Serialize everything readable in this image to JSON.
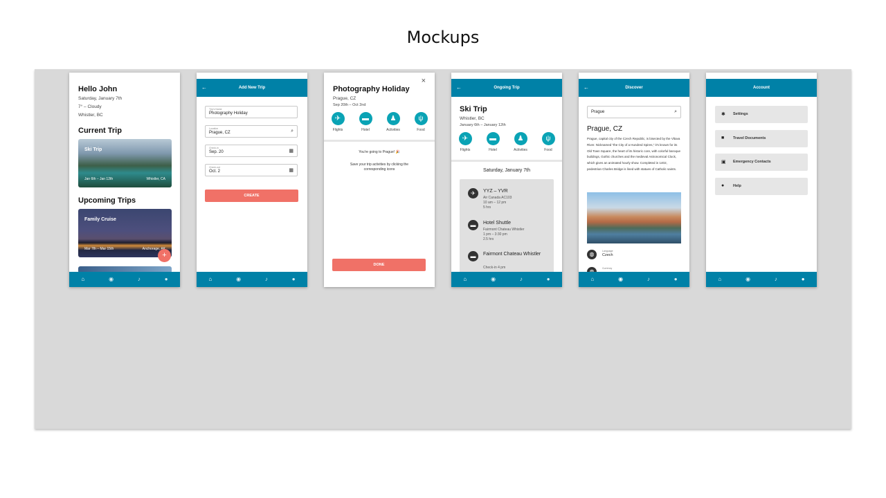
{
  "title": "Mockups",
  "nav_icons": [
    "home-icon",
    "compass-icon",
    "bell-icon",
    "person-icon"
  ],
  "colors": {
    "primary": "#0081a7",
    "accent": "#f07167",
    "icon_teal": "#0aa3b5",
    "board": "#d9d9d9"
  },
  "screen1": {
    "greeting": "Hello John",
    "date": "Saturday, January 7th",
    "weather": "7° – Cloudy",
    "location": "Whistler, BC",
    "current_title": "Current Trip",
    "current_card": {
      "title": "Ski Trip",
      "dates": "Jan 6th – Jan 12th",
      "place": "Whistler, CA"
    },
    "upcoming_title": "Upcoming Trips",
    "upcoming_card": {
      "title": "Family Cruise",
      "dates": "Mar 7th – Mar 15th",
      "place": "Anchorage, AK"
    },
    "fab": "+"
  },
  "screen2": {
    "appbar": "Add New Trip",
    "fields": [
      {
        "label": "Trip's Name",
        "value": "Photography Holiday",
        "icon": ""
      },
      {
        "label": "Location",
        "value": "Prague, CZ",
        "icon": "search-icon"
      },
      {
        "label": "Check-in",
        "value": "Sep. 20",
        "icon": "calendar-icon"
      },
      {
        "label": "Check-out",
        "value": "Oct. 2",
        "icon": "calendar-icon"
      }
    ],
    "button": "CREATE"
  },
  "screen3": {
    "title": "Photography Holiday",
    "location": "Prague, CZ",
    "dates": "Sep 20th – Oct 2nd",
    "close": "×",
    "categories": [
      "Flights",
      "Hotel",
      "Activities",
      "Food"
    ],
    "message1": "You're going to Prague! 🎉",
    "message2": "Save your trip activities by clicking the corresponding icons",
    "button": "DONE"
  },
  "screen4": {
    "appbar": "Ongoing Trip",
    "title": "Ski Trip",
    "location": "Whistler, BC",
    "dates": "January 6th – January 12th",
    "categories": [
      "Flights",
      "Hotel",
      "Activities",
      "Food"
    ],
    "day": "Saturday, January 7th",
    "items": [
      {
        "icon": "plane-icon",
        "title": "YYZ – YVR",
        "details": [
          "Air Canada AC103",
          "10 am – 12 pm",
          "5 hrs"
        ]
      },
      {
        "icon": "bed-icon",
        "title": "Hotel Shuttle",
        "details": [
          "Fairmont Chateau Whistler",
          "1 pm – 3:30 pm",
          "2.5 hrs"
        ]
      },
      {
        "icon": "bed-icon",
        "title": "Fairmont Chateau Whistler",
        "details": [
          "Check-in 4 pm"
        ]
      }
    ]
  },
  "screen5": {
    "appbar": "Discover",
    "search_value": "Prague",
    "title": "Prague, CZ",
    "description": "Prague, capital city of the Czech Republic, is bisected by the Vltava River. Nicknamed “the City of a Hundred Spires,” it's known for its Old Town Square, the heart of its historic core, with colorful baroque buildings, Gothic churches and the medieval Astronomical Clock, which gives an animated hourly show. Completed in 1402, pedestrian Charles Bridge is lined with statues of Catholic saints.",
    "meta": [
      {
        "label": "Language",
        "value": "Czech"
      },
      {
        "label": "Currency",
        "value": ""
      }
    ]
  },
  "screen6": {
    "appbar": "Account",
    "items": [
      {
        "icon": "gear-icon",
        "label": "Settings"
      },
      {
        "icon": "folder-icon",
        "label": "Travel Documents"
      },
      {
        "icon": "contact-card-icon",
        "label": "Emergency Contacts"
      },
      {
        "icon": "help-icon",
        "label": "Help"
      }
    ]
  }
}
